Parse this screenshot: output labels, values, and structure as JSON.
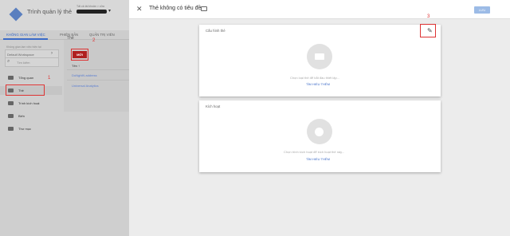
{
  "app": {
    "title": "Trình quản lý thẻ",
    "account_small": "Tất cả tài khoản > cửa",
    "tabs": [
      "KHÔNG GIAN LÀM VIỆC",
      "PHIÊN BẢN",
      "QUẢN TRỊ VIÊN"
    ],
    "workspace_label": "Không gian làm việc hiện tại",
    "workspace_value": "Default Workspace",
    "search_placeholder": "Tìm kiếm",
    "menu": [
      "Tổng quan",
      "Thẻ",
      "Trình kích hoạt",
      "Biến",
      "Thư mục"
    ]
  },
  "table": {
    "section_title": "Thẻ",
    "new_button": "MỚI",
    "column_header": "Tên ↑",
    "rows": [
      "DoNghiN address",
      "Universal Analytics"
    ]
  },
  "annotations": [
    "1",
    "2",
    "3"
  ],
  "editor": {
    "title": "Thẻ không có tiêu đề",
    "save_label": "LƯU",
    "card1": {
      "title": "Cấu hình thẻ",
      "desc": "Chọn loại thẻ để bắt đầu thiết lập...",
      "link": "TÌM HIỂU THÊM"
    },
    "card2": {
      "title": "Kích hoạt",
      "desc": "Chọn trình kích hoạt để kích hoạt thẻ này...",
      "link": "TÌM HIỂU THÊM"
    }
  },
  "colors": {
    "accent": "#3b6ac7",
    "annotation": "#dd3333",
    "new_button": "#b02020"
  }
}
